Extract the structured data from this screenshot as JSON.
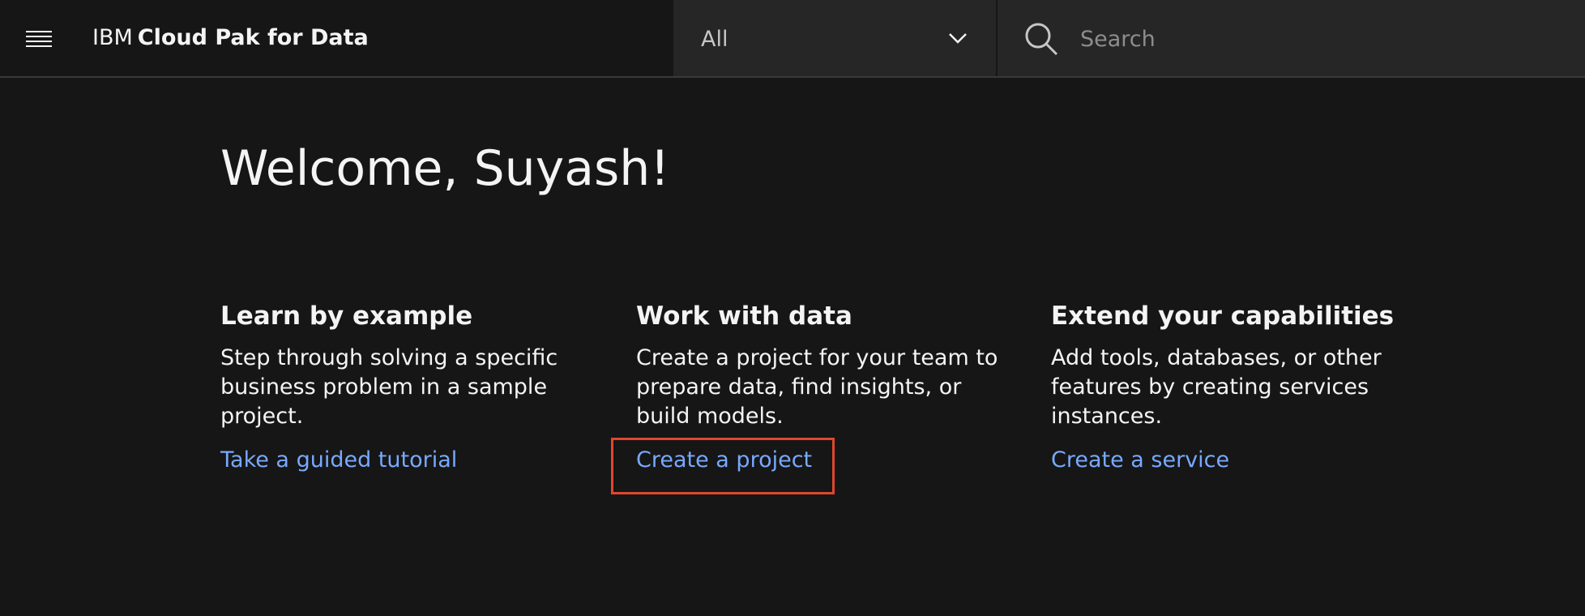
{
  "header": {
    "menu_icon": "hamburger-menu-icon",
    "brand_prefix": "IBM",
    "brand_name": "Cloud Pak for Data",
    "scope_selected": "All",
    "scope_icon": "chevron-down-icon",
    "search_icon": "search-icon",
    "search_placeholder": "Search",
    "search_value": ""
  },
  "main": {
    "welcome": "Welcome, Suyash!",
    "cards": [
      {
        "title": "Learn by example",
        "description": "Step through solving a specific business problem in a sample project.",
        "link": "Take a guided tutorial"
      },
      {
        "title": "Work with data",
        "description": "Create a project for your team to prepare data, find insights, or build models.",
        "link": "Create a project"
      },
      {
        "title": "Extend your capabilities",
        "description": "Add tools, databases, or other features by creating services instances.",
        "link": "Create a service"
      }
    ]
  },
  "colors": {
    "background": "#161616",
    "header_field": "#262626",
    "text": "#f4f4f4",
    "link": "#78a9ff",
    "highlight": "#e0462f"
  }
}
